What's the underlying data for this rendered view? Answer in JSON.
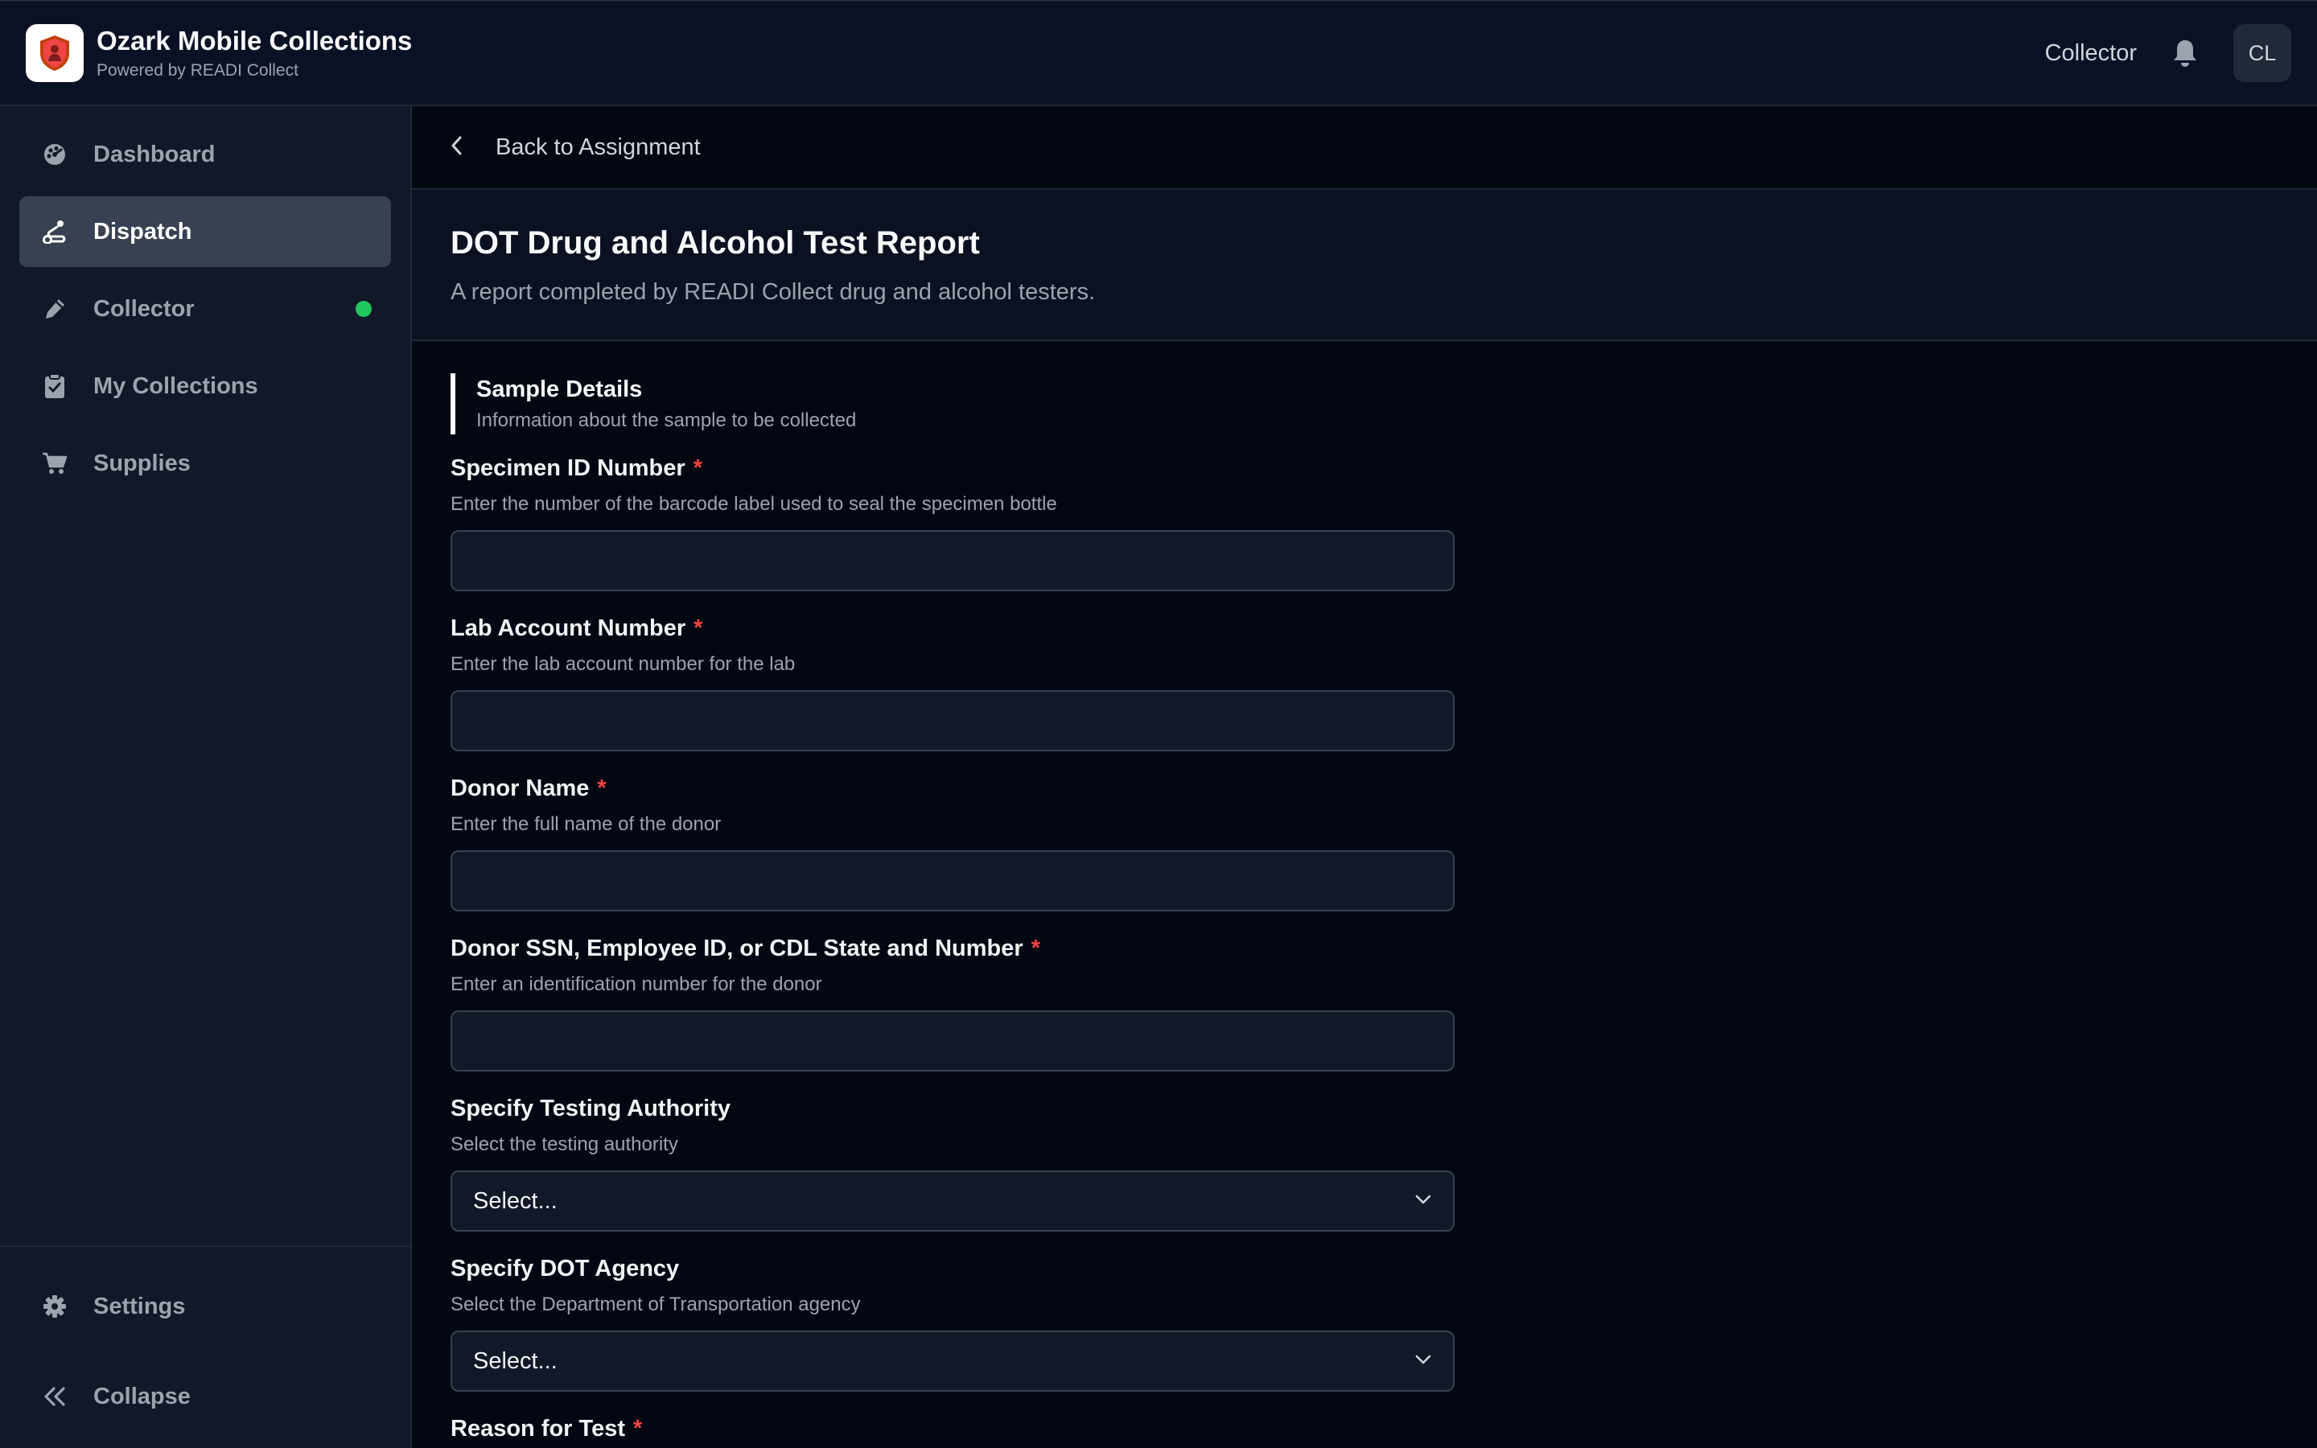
{
  "header": {
    "app_title": "Ozark Mobile Collections",
    "app_subtitle": "Powered by READI Collect",
    "role": "Collector",
    "avatar_initials": "CL"
  },
  "sidebar": {
    "items": [
      {
        "label": "Dashboard",
        "icon": "palette-icon",
        "active": false
      },
      {
        "label": "Dispatch",
        "icon": "route-icon",
        "active": true
      },
      {
        "label": "Collector",
        "icon": "pen-icon",
        "active": false,
        "status": "online"
      },
      {
        "label": "My Collections",
        "icon": "clipboard-check-icon",
        "active": false
      },
      {
        "label": "Supplies",
        "icon": "cart-icon",
        "active": false
      }
    ],
    "bottom": [
      {
        "label": "Settings",
        "icon": "gear-icon"
      },
      {
        "label": "Collapse",
        "icon": "double-chevron-left-icon"
      }
    ]
  },
  "main": {
    "back_label": "Back to Assignment",
    "title": "DOT Drug and Alcohol Test Report",
    "subtitle": "A report completed by READI Collect drug and alcohol testers.",
    "section": {
      "title": "Sample Details",
      "subtitle": "Information about the sample to be collected"
    },
    "fields": [
      {
        "label": "Specimen ID Number",
        "required": "*",
        "help": "Enter the number of the barcode label used to seal the specimen bottle",
        "value": ""
      },
      {
        "label": "Lab Account Number",
        "required": "*",
        "help": "Enter the lab account number for the lab",
        "value": ""
      },
      {
        "label": "Donor Name",
        "required": "*",
        "help": "Enter the full name of the donor",
        "value": ""
      },
      {
        "label": "Donor SSN, Employee ID, or CDL State and Number",
        "required": "*",
        "help": "Enter an identification number for the donor",
        "value": ""
      }
    ],
    "selects": [
      {
        "label": "Specify Testing Authority",
        "help": "Select the testing authority",
        "value": "Select..."
      },
      {
        "label": "Specify DOT Agency",
        "help": "Select the Department of Transportation agency",
        "value": "Select..."
      }
    ],
    "partial_field": {
      "label": "Reason for Test",
      "required": "*"
    }
  },
  "colors": {
    "background": "#030712",
    "sidebar": "#111827",
    "active_nav": "#374151",
    "required": "#ef4444",
    "status_online": "#22c55e"
  }
}
